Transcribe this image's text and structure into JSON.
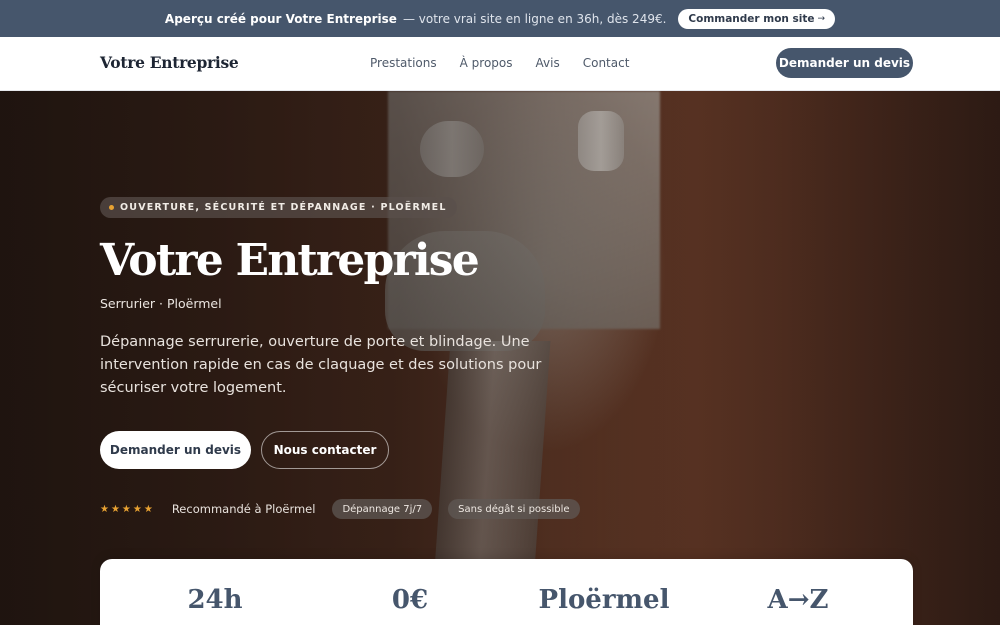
{
  "promo": {
    "lead": "Aperçu créé pour Votre Entreprise",
    "rest": "— votre vrai site en ligne en 36h, dès 249€.",
    "button_label": "Commander mon site",
    "button_icon": "arrow-right-icon"
  },
  "header": {
    "brand": "Votre Entreprise",
    "nav": [
      "Prestations",
      "À propos",
      "Avis",
      "Contact"
    ],
    "cta_label": "Demander un devis"
  },
  "hero": {
    "tag": "OUVERTURE, SÉCURITÉ ET DÉPANNAGE · PLOËRMEL",
    "title": "Votre Entreprise",
    "subtitle": "Serrurier · Ploërmel",
    "description": "Dépannage serrurerie, ouverture de porte et blindage. Une intervention rapide en cas de claquage et des solutions pour sécuriser votre logement.",
    "primary_button": "Demander un devis",
    "secondary_button": "Nous contacter",
    "rating_stars": "★★★★★",
    "rating_value": 5,
    "recommend_text": "Recommandé à Ploërmel",
    "badges": [
      "Dépannage 7j/7",
      "Sans dégât si possible"
    ]
  },
  "stats": [
    "24h",
    "0€",
    "Ploërmel",
    "A→Z"
  ],
  "colors": {
    "primary": "#46566c",
    "accent": "#e8a232",
    "white": "#ffffff"
  }
}
